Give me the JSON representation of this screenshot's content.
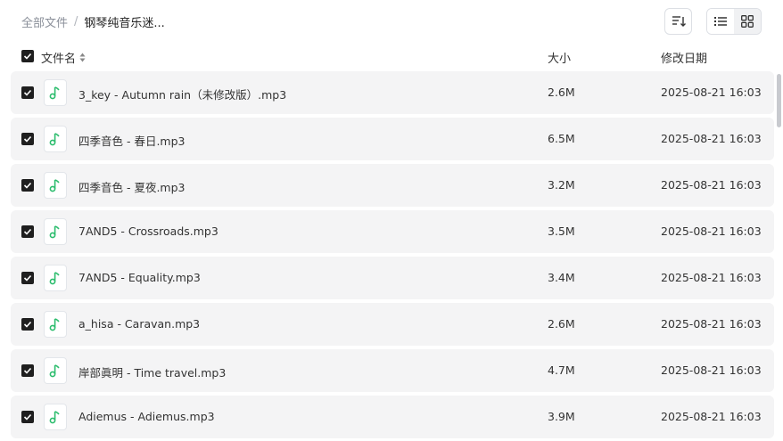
{
  "breadcrumb": {
    "root": "全部文件",
    "separator": "/",
    "current": "钢琴纯音乐迷..."
  },
  "icons": {
    "sort": "sort-lines-icon",
    "list_view": "list-view-icon",
    "grid_view": "grid-view-icon",
    "file": "music-note-icon",
    "check": "check-icon"
  },
  "colors": {
    "accent": "#1f1f1f",
    "music_icon": "#2dbd6e",
    "row_bg": "#f4f4f5"
  },
  "header": {
    "name": "文件名",
    "size": "大小",
    "date": "修改日期"
  },
  "files": [
    {
      "name": "3_key - Autumn rain（未修改版）.mp3",
      "size": "2.6M",
      "date": "2025-08-21 16:03"
    },
    {
      "name": "四季音色 - 春日.mp3",
      "size": "6.5M",
      "date": "2025-08-21 16:03"
    },
    {
      "name": "四季音色 - 夏夜.mp3",
      "size": "3.2M",
      "date": "2025-08-21 16:03"
    },
    {
      "name": "7AND5 - Crossroads.mp3",
      "size": "3.5M",
      "date": "2025-08-21 16:03"
    },
    {
      "name": "7AND5 - Equality.mp3",
      "size": "3.4M",
      "date": "2025-08-21 16:03"
    },
    {
      "name": "a_hisa - Caravan.mp3",
      "size": "2.6M",
      "date": "2025-08-21 16:03"
    },
    {
      "name": "岸部眞明 - Time travel.mp3",
      "size": "4.7M",
      "date": "2025-08-21 16:03"
    },
    {
      "name": "Adiemus - Adiemus.mp3",
      "size": "3.9M",
      "date": "2025-08-21 16:03"
    }
  ]
}
